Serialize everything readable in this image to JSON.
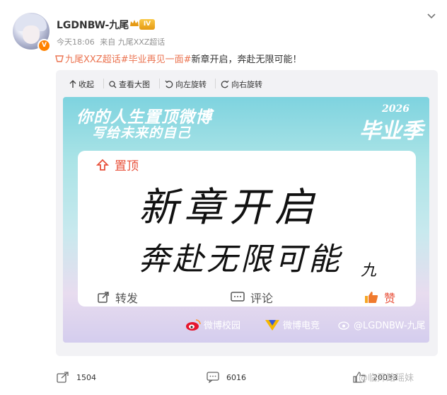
{
  "author": {
    "name": "LGDNBW-九尾",
    "level": "IV",
    "verified_badge": "V"
  },
  "meta": {
    "time": "今天18:06",
    "source": "来自 九尾XXZ超话"
  },
  "post": {
    "topic": "九尾XXZ超话",
    "hashtag": "#毕业再见一面#",
    "text": "新章开启，奔赴无限可能！"
  },
  "toolbar": {
    "collapse": "收起",
    "view_large": "查看大图",
    "rotate_left": "向左旋转",
    "rotate_right": "向右旋转"
  },
  "image": {
    "slogan_line1": "你的人生置顶微博",
    "slogan_line2": "写给未来的自己",
    "year": "2026",
    "season": "毕业季",
    "pin_label": "置顶",
    "handwriting_line1": "新章开启",
    "handwriting_line2": "奔赴无限可能",
    "signature": "九",
    "forward_label": "转发",
    "comment_label": "评论",
    "like_label": "赞",
    "logo_campus": "微博校园",
    "logo_esports": "微博电竞",
    "watermark": "@LGDNBW-九尾"
  },
  "footer": {
    "reposts": "1504",
    "comments": "6016",
    "likes": "20033"
  },
  "watermark": "@临开路瑶妹",
  "colors": {
    "accent": "#ff8200",
    "tag": "#eb7350",
    "like": "#e8503a"
  }
}
